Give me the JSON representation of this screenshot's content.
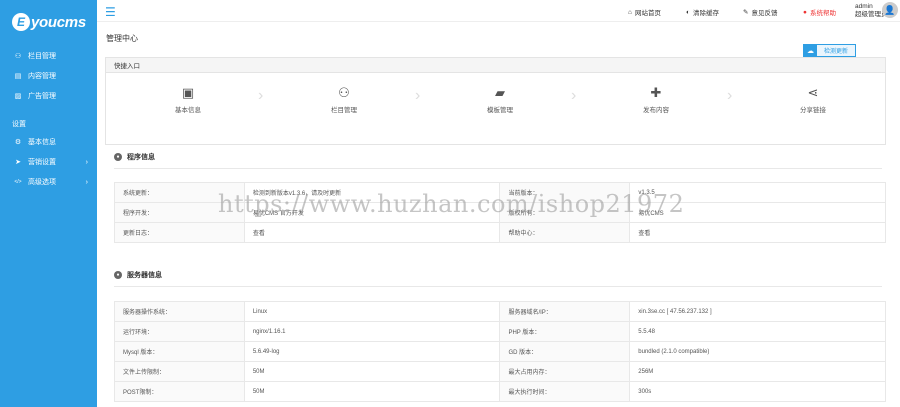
{
  "brand": {
    "logo_letter": "E",
    "logo_text": "youcms"
  },
  "sidebar": {
    "items": [
      {
        "icon": "sitemap-icon",
        "glyph": "⚇",
        "label": "栏目管理"
      },
      {
        "icon": "list-icon",
        "glyph": "▤",
        "label": "内容管理"
      },
      {
        "icon": "image-icon",
        "glyph": "▨",
        "label": "广告管理"
      }
    ],
    "group_label": "设置",
    "settings": [
      {
        "icon": "gear-icon",
        "glyph": "⚙",
        "label": "基本信息",
        "chev": ""
      },
      {
        "icon": "send-icon",
        "glyph": "➤",
        "label": "营销设置",
        "chev": "›"
      },
      {
        "icon": "code-icon",
        "glyph": "</>",
        "label": "高级选项",
        "chev": "›"
      }
    ]
  },
  "topbar": {
    "home": "网站首页",
    "cache": "清除缓存",
    "feedback": "意见反馈",
    "help": "系统帮助",
    "admin_name": "admin",
    "admin_role": "超级管理员"
  },
  "page": {
    "title": "管理中心",
    "upgrade_label": "检测更新"
  },
  "quick": {
    "header": "快捷入口",
    "items": [
      {
        "icon": "id-card-icon",
        "glyph": "▣",
        "label": "基本信息"
      },
      {
        "icon": "sitemap-icon",
        "glyph": "⚇",
        "label": "栏目管理"
      },
      {
        "icon": "folder-open-icon",
        "glyph": "▰",
        "label": "模板管理"
      },
      {
        "icon": "plus-icon",
        "glyph": "✚",
        "label": "发布内容"
      },
      {
        "icon": "share-icon",
        "glyph": "⋖",
        "label": "分享链接"
      }
    ]
  },
  "system_info": {
    "title": "程序信息",
    "rows": [
      [
        "系统更新：",
        "检测到新版本v1.3.6，请及时更新",
        "当前版本：",
        "v1.3.5"
      ],
      [
        "程序开发：",
        "易优CMS 官方开发",
        "版权所有：",
        "易优CMS"
      ],
      [
        "更新日志：",
        "查看",
        "帮助中心：",
        "查看"
      ]
    ]
  },
  "server_info": {
    "title": "服务器信息",
    "rows": [
      [
        "服务器操作系统：",
        "Linux",
        "服务器域名/IP：",
        "xin.3se.cc [ 47.56.237.132 ]"
      ],
      [
        "运行环境：",
        "nginx/1.16.1",
        "PHP 版本：",
        "5.5.48"
      ],
      [
        "Mysql 版本：",
        "5.6.49-log",
        "GD 版本：",
        "bundled (2.1.0 compatible)"
      ],
      [
        "文件上传限制：",
        "50M",
        "最大占用内存：",
        "256M"
      ],
      [
        "POST限制：",
        "50M",
        "最大执行时间：",
        "300s"
      ]
    ]
  },
  "watermark": "https://www.huzhan.com/ishop21972"
}
